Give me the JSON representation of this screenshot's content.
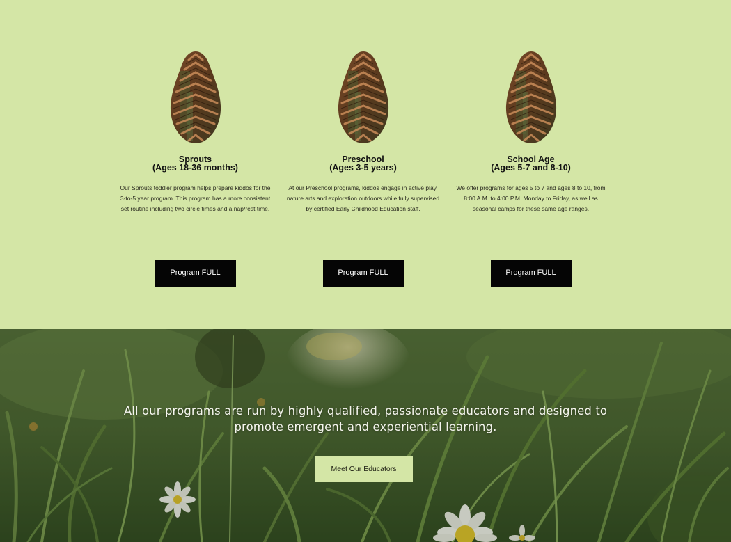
{
  "programs": [
    {
      "title": "Sprouts",
      "ages": "(Ages 18-36 months)",
      "description": "Our Sprouts toddler program helps prepare kiddos for the 3-to-5 year program. This program has a more consistent set routine including two circle times and a nap/rest time.",
      "button_label": "Program FULL"
    },
    {
      "title": "Preschool",
      "ages": "(Ages 3-5 years)",
      "description": "At our Preschool programs, kiddos engage in active play, nature arts and exploration outdoors while fully supervised by certified Early Childhood Education staff.",
      "button_label": "Program FULL"
    },
    {
      "title": "School Age",
      "ages": "(Ages 5-7 and 8-10)",
      "description": "We offer programs for ages 5 to 7 and ages 8 to 10, from 8:00 A.M. to 4:00 P.M. Monday to Friday, as well as seasonal camps for these same age ranges.",
      "button_label": "Program FULL"
    }
  ],
  "hero": {
    "tagline": "All our programs are run by highly qualified, passionate educators and designed to promote emergent and experiential learning.",
    "cta_label": "Meet Our Educators"
  },
  "colors": {
    "section_background": "#d4e6a6",
    "button_background": "#050505",
    "button_text": "#ffffff",
    "cta_background": "#d4e6a6"
  },
  "icons": {
    "program_image": "pinecone-image"
  }
}
